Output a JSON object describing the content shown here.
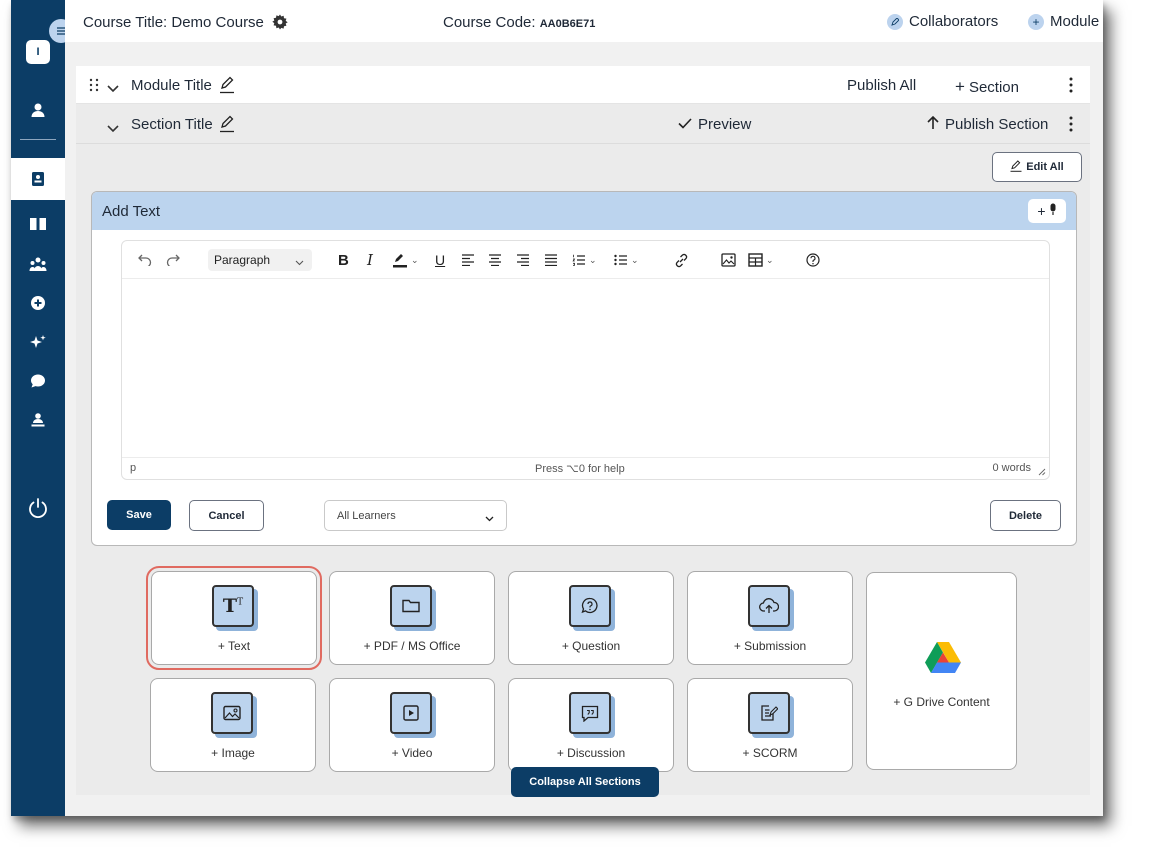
{
  "app": {
    "user_initial": "I",
    "accent_color": "#0c3d66",
    "highlight_color": "#bcd4ee"
  },
  "topbar": {
    "course_title_label": "Course Title: Demo Course",
    "course_code_label": "Course Code:",
    "course_code_value": "AA0B6E71",
    "collaborators": "Collaborators",
    "module": "Module"
  },
  "module": {
    "title": "Module Title",
    "publish_all": "Publish All",
    "add_section": "Section"
  },
  "section": {
    "title": "Section Title",
    "preview": "Preview",
    "publish_section": "Publish Section",
    "edit_all": "Edit All"
  },
  "editor": {
    "header": "Add Text",
    "add_voice": "+",
    "block_format": "Paragraph",
    "status_path": "p",
    "status_help": "Press ⌥0 for help",
    "word_count": "0 words",
    "save": "Save",
    "cancel": "Cancel",
    "audience": "All Learners",
    "delete": "Delete"
  },
  "tiles": [
    {
      "label": "+ Text",
      "icon": "text-format-icon"
    },
    {
      "label": "+ PDF / MS Office",
      "icon": "folder-icon"
    },
    {
      "label": "+ Question",
      "icon": "question-icon"
    },
    {
      "label": "+ Submission",
      "icon": "cloud-upload-icon"
    },
    {
      "label": "+ Image",
      "icon": "image-icon"
    },
    {
      "label": "+ Video",
      "icon": "video-icon"
    },
    {
      "label": "+ Discussion",
      "icon": "discussion-icon"
    },
    {
      "label": "+ SCORM",
      "icon": "scorm-icon"
    }
  ],
  "gdrive": {
    "label": "+ G Drive Content",
    "icon": "google-drive-icon"
  },
  "collapse_all": "Collapse All Sections"
}
